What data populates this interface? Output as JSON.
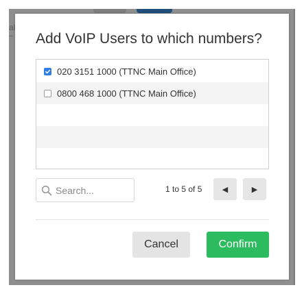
{
  "background": {
    "fragment_text": "al"
  },
  "modal": {
    "title": "Add VoIP Users to which numbers?",
    "numbers": [
      {
        "label": "020 3151 1000 (TTNC Main Office)",
        "checked": true
      },
      {
        "label": "0800 468 1000 (TTNC Main Office)",
        "checked": false
      }
    ],
    "search": {
      "placeholder": "Search...",
      "value": ""
    },
    "pagination": {
      "text": "1 to 5 of 5",
      "prev_glyph": "◀",
      "next_glyph": "▶"
    },
    "buttons": {
      "cancel_label": "Cancel",
      "confirm_label": "Confirm"
    }
  },
  "colors": {
    "accent_checkbox": "#2f7ee8",
    "confirm_button": "#2dbb5f",
    "overlay": "#8f8f8f"
  }
}
